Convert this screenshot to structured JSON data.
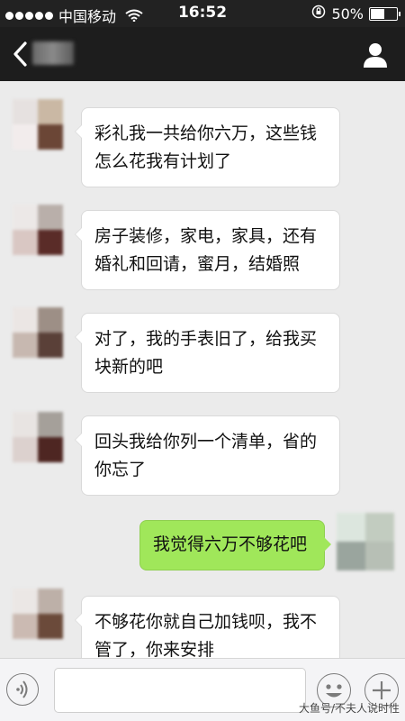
{
  "status_bar": {
    "carrier": "中国移动",
    "time": "16:52",
    "battery": "50%",
    "battery_level": 0.5
  },
  "nav": {
    "back_icon": "chevron-left-icon",
    "profile_icon": "person-icon"
  },
  "messages": [
    {
      "side": "in",
      "lines": [
        "彩礼我一共给你六万，这些钱",
        "怎么花我有计划了"
      ]
    },
    {
      "side": "in",
      "lines": [
        "房子装修，家电，家具，还有",
        "婚礼和回请，蜜月，结婚照"
      ]
    },
    {
      "side": "in",
      "lines": [
        "对了，我的手表旧了，给我买",
        "块新的吧"
      ]
    },
    {
      "side": "in",
      "lines": [
        "回头我给你列一个清单，省的",
        "你忘了"
      ]
    },
    {
      "side": "out",
      "lines": [
        "我觉得六万不够花吧"
      ]
    },
    {
      "side": "in",
      "lines": [
        "不够花你就自己加钱呗，我不",
        "管了，你来安排"
      ]
    }
  ],
  "input_bar": {
    "voice_icon": "voice-icon",
    "emoji_icon": "emoji-icon",
    "plus_icon": "plus-icon",
    "text_value": ""
  },
  "watermark": "大鱼号/不夫人说时性"
}
